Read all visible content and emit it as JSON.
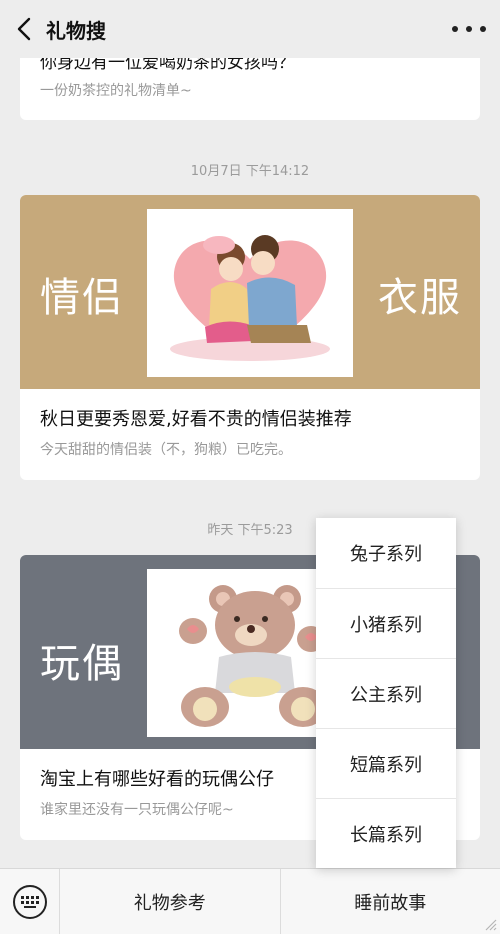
{
  "header": {
    "title": "礼物搜"
  },
  "articles": [
    {
      "title": "你身边有一位爱喝奶茶的女孩吗？",
      "subtitle": "一份奶茶控的礼物清单~"
    },
    {
      "timestamp": "10月7日 下午14:12",
      "banner_left": "情侣",
      "banner_right": "衣服",
      "title": "秋日更要秀恩爱,好看不贵的情侣装推荐",
      "subtitle": "今天甜甜的情侣装（不，狗粮）已吃完。"
    },
    {
      "timestamp": "昨天 下午5:23",
      "banner_left": "玩偶",
      "title": "淘宝上有哪些好看的玩偶公仔",
      "subtitle": "谁家里还没有一只玩偶公仔呢~"
    }
  ],
  "popup_menu": [
    "兔子系列",
    "小猪系列",
    "公主系列",
    "短篇系列",
    "长篇系列"
  ],
  "bottom_menu": [
    "礼物参考",
    "睡前故事"
  ],
  "colors": {
    "banner_tan": "#c6a97b",
    "banner_gray": "#6e737c",
    "background": "#ededed"
  }
}
